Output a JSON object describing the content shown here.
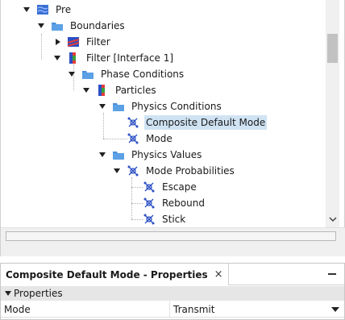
{
  "tree": {
    "items": [
      {
        "label": "Pre",
        "icon": "region-icon"
      },
      {
        "label": "Boundaries",
        "icon": "folder-icon"
      },
      {
        "label": "Filter",
        "icon": "boundary-icon"
      },
      {
        "label": "Filter [Interface 1]",
        "icon": "interface-boundary-icon"
      },
      {
        "label": "Phase Conditions",
        "icon": "folder-icon"
      },
      {
        "label": "Particles",
        "icon": "phase-icon"
      },
      {
        "label": "Physics Conditions",
        "icon": "folder-icon"
      },
      {
        "label": "Composite Default Mode",
        "icon": "condition-icon"
      },
      {
        "label": "Mode",
        "icon": "condition-icon"
      },
      {
        "label": "Physics Values",
        "icon": "folder-icon"
      },
      {
        "label": "Mode Probabilities",
        "icon": "condition-icon"
      },
      {
        "label": "Escape",
        "icon": "condition-icon"
      },
      {
        "label": "Rebound",
        "icon": "condition-icon"
      },
      {
        "label": "Stick",
        "icon": "condition-icon"
      }
    ],
    "selected": "Composite Default Mode"
  },
  "properties": {
    "title": "Composite Default Mode - Properties",
    "close_glyph": "×",
    "section": "Properties",
    "rows": [
      {
        "name": "Mode",
        "value": "Transmit"
      }
    ]
  },
  "colors": {
    "selection": "#cfe3f3",
    "folder": "#4a90d9",
    "section_bg": "#e6e6e6"
  }
}
